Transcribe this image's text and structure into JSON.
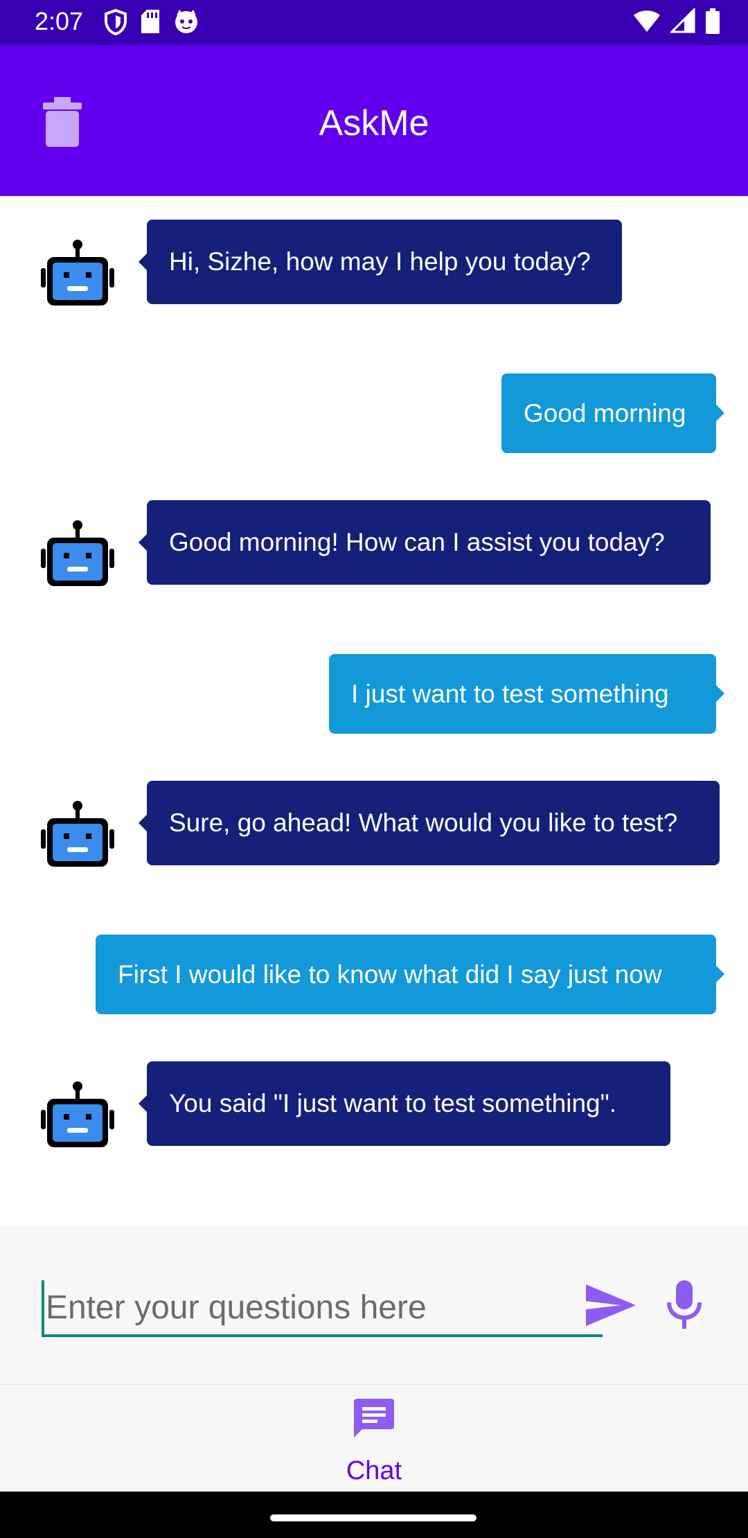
{
  "status_bar": {
    "time": "2:07",
    "left_icons": [
      "shield-icon",
      "sd-card-icon",
      "android-cat-icon"
    ],
    "right_icons": [
      "wifi-icon",
      "cell-signal-icon",
      "battery-icon"
    ]
  },
  "app_bar": {
    "title": "AskMe",
    "delete_icon": "trash-icon"
  },
  "messages": [
    {
      "sender": "bot",
      "text": "Hi, Sizhe, how may I help you today?"
    },
    {
      "sender": "user",
      "text": "Good morning"
    },
    {
      "sender": "bot",
      "text": "Good morning! How can I assist you today?"
    },
    {
      "sender": "user",
      "text": "I just want to test something"
    },
    {
      "sender": "bot",
      "text": "Sure, go ahead! What would you like to test?"
    },
    {
      "sender": "user",
      "text": "First I would like to know what did I say just now"
    },
    {
      "sender": "bot",
      "text": "You said \"I just want to test something\"."
    }
  ],
  "input": {
    "value": "",
    "placeholder": "Enter your questions here",
    "send_icon": "send-icon",
    "mic_icon": "microphone-icon"
  },
  "bottom_nav": {
    "items": [
      {
        "label": "Chat",
        "icon": "chat-icon",
        "selected": true
      }
    ]
  },
  "colors": {
    "status_bar": "#3700b3",
    "app_bar": "#6200ee",
    "bot_bubble": "#13217a",
    "user_bubble": "#1398da",
    "accent_purple": "#8e5cf0",
    "input_underline": "#0b8a80"
  }
}
